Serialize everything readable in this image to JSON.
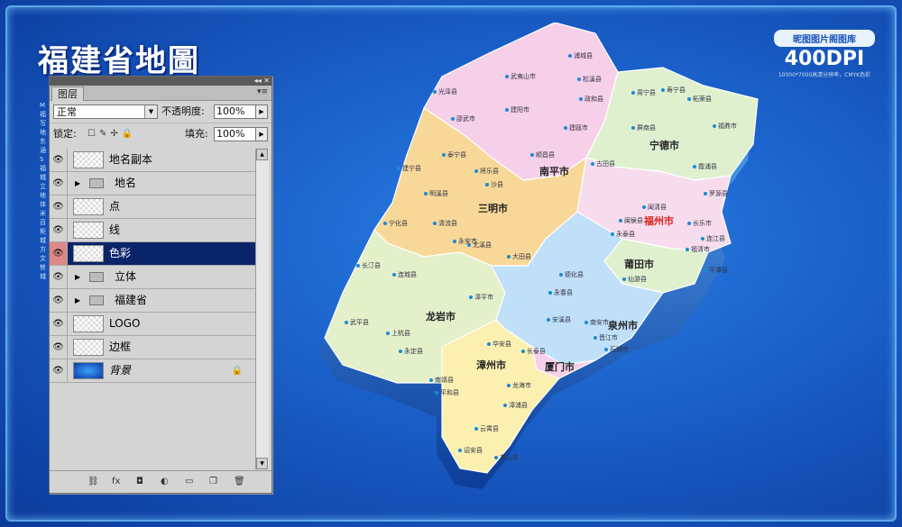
{
  "page": {
    "title": "福建省地圖",
    "left_column_chars": [
      "M",
      "福",
      "写",
      "地",
      "东",
      "涵",
      "S",
      "福",
      "城",
      "立",
      "地",
      "体",
      "米",
      "百",
      "矩",
      "城",
      "方",
      "文",
      "势",
      "城"
    ]
  },
  "brand": {
    "badge": "昵图图片阁图库",
    "dpi": "400DPI",
    "sub": "10000*7000高清分辨率，CMYK色彩"
  },
  "colors": {
    "background": "#1a5fc8",
    "selected_layer": "#0a246a",
    "panel": "#d4d4d4"
  },
  "panel": {
    "tab": "图层",
    "blend_mode": "正常",
    "opacity_label": "不透明度:",
    "opacity_value": "100%",
    "lock_label": "锁定:",
    "fill_label": "填充:",
    "fill_value": "100%",
    "layers": [
      {
        "name": "地名副本",
        "type": "layer"
      },
      {
        "name": "地名",
        "type": "group"
      },
      {
        "name": "点",
        "type": "layer"
      },
      {
        "name": "线",
        "type": "layer"
      },
      {
        "name": "色彩",
        "type": "layer",
        "selected": true
      },
      {
        "name": "立体",
        "type": "group"
      },
      {
        "name": "福建省",
        "type": "group"
      },
      {
        "name": "LOGO",
        "type": "layer"
      },
      {
        "name": "边框",
        "type": "layer"
      },
      {
        "name": "背景",
        "type": "background"
      }
    ],
    "footer_icons": [
      "link-icon",
      "fx-icon",
      "mask-icon",
      "adjustment-icon",
      "new-group-icon",
      "new-layer-icon",
      "trash-icon"
    ]
  },
  "map": {
    "prefectures": [
      {
        "name": "南平市"
      },
      {
        "name": "宁德市"
      },
      {
        "name": "三明市"
      },
      {
        "name": "福州市",
        "capital": true
      },
      {
        "name": "莆田市"
      },
      {
        "name": "龙岩市"
      },
      {
        "name": "泉州市"
      },
      {
        "name": "漳州市"
      },
      {
        "name": "厦门市"
      }
    ],
    "cities": [
      "浦城县",
      "武夷山市",
      "松溪县",
      "光泽县",
      "建阳市",
      "政和县",
      "邵武市",
      "周宁县",
      "寿宁县",
      "柘荣县",
      "建瓯市",
      "福鼎市",
      "顺昌县",
      "屏南县",
      "泰宁县",
      "将乐县",
      "古田县",
      "霞浦县",
      "建宁县",
      "沙县",
      "罗源县",
      "连江县",
      "明溪县",
      "闽清县",
      "清流县",
      "尤溪县",
      "闽侯县",
      "长乐市",
      "宁化县",
      "永安市",
      "永泰县",
      "福清市",
      "大田县",
      "平潭县",
      "长汀县",
      "连城县",
      "德化县",
      "仙游县",
      "永春县",
      "漳平市",
      "安溪县",
      "南安市",
      "晋江市",
      "石狮市",
      "武平县",
      "上杭县",
      "华安县",
      "长泰县",
      "永定县",
      "南靖县",
      "龙海市",
      "平和县",
      "漳浦县",
      "云霄县",
      "诏安县",
      "东山县"
    ]
  }
}
